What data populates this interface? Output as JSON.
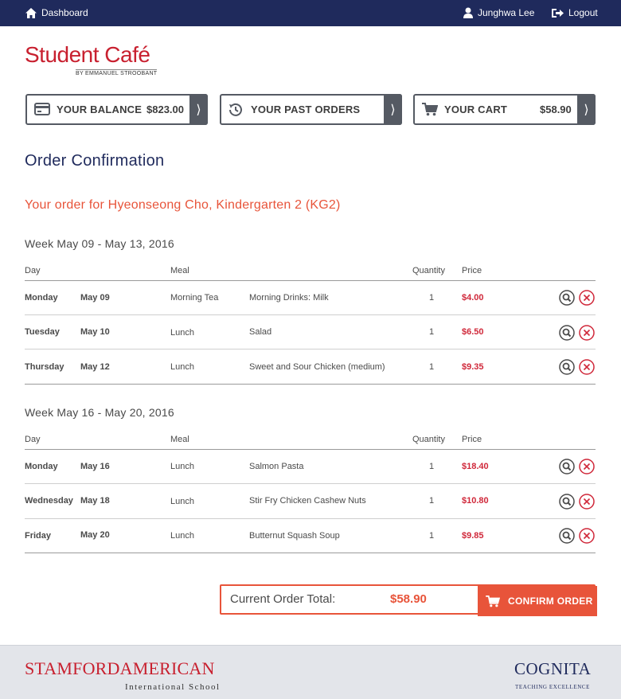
{
  "topbar": {
    "dashboard_label": "Dashboard",
    "user_name": "Junghwa Lee",
    "logout_label": "Logout"
  },
  "logo": {
    "name": "Student Café",
    "byline": "BY EMMANUEL STROOBANT"
  },
  "cards": {
    "balance": {
      "label": "YOUR BALANCE",
      "value": "$823.00"
    },
    "past_orders": {
      "label": "YOUR PAST ORDERS"
    },
    "cart": {
      "label": "YOUR CART",
      "value": "$58.90"
    }
  },
  "page_title": "Order Confirmation",
  "order_for": "Your order for Hyeonseong Cho, Kindergarten 2 (KG2)",
  "columns": {
    "day": "Day",
    "meal": "Meal",
    "quantity": "Quantity",
    "price": "Price"
  },
  "weeks": [
    {
      "title": "Week May 09 - May 13, 2016",
      "rows": [
        {
          "day": "Monday",
          "date": "May 09",
          "meal": "Morning Tea",
          "item": "Morning Drinks: Milk",
          "qty": "1",
          "price": "$4.00"
        },
        {
          "day": "Tuesday",
          "date": "May 10",
          "meal": "Lunch",
          "item": "Salad",
          "qty": "1",
          "price": "$6.50"
        },
        {
          "day": "Thursday",
          "date": "May 12",
          "meal": "Lunch",
          "item": "Sweet and Sour Chicken (medium)",
          "qty": "1",
          "price": "$9.35"
        }
      ]
    },
    {
      "title": "Week May 16 - May 20, 2016",
      "rows": [
        {
          "day": "Monday",
          "date": "May 16",
          "meal": "Lunch",
          "item": "Salmon Pasta",
          "qty": "1",
          "price": "$18.40"
        },
        {
          "day": "Wednesday",
          "date": "May 18",
          "meal": "Lunch",
          "item": "Stir Fry Chicken Cashew Nuts",
          "qty": "1",
          "price": "$10.80"
        },
        {
          "day": "Friday",
          "date": "May 20",
          "meal": "Lunch",
          "item": "Butternut Squash Soup",
          "qty": "1",
          "price": "$9.85"
        }
      ]
    }
  ],
  "total": {
    "label": "Current Order Total:",
    "value": "$58.90",
    "confirm_label": "CONFIRM ORDER"
  },
  "footer": {
    "school_name": "STAMFORDAMERICAN",
    "school_sub": "International School",
    "partner_name": "COGNITA",
    "partner_sub": "TEACHING EXCELLENCE"
  },
  "colors": {
    "navy": "#1f2a5c",
    "brand_red": "#c8202f",
    "accent_orange": "#e8543a",
    "price_red": "#d0283a"
  },
  "icons": {
    "dashboard": "home-icon",
    "user": "user-icon",
    "logout": "logout-icon",
    "balance": "credit-card-icon",
    "past_orders": "history-icon",
    "cart": "cart-icon",
    "view": "magnifier-icon",
    "remove": "close-circle-icon"
  }
}
